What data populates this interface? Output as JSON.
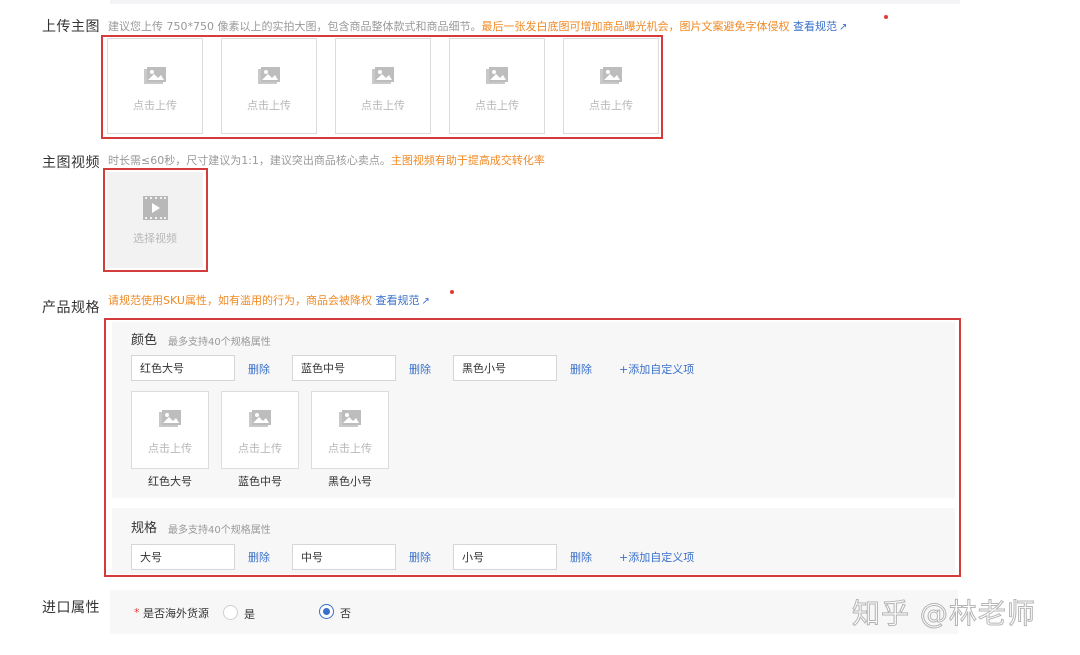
{
  "main_image": {
    "label": "上传主图",
    "hint_gray": "建议您上传 750*750 像素以上的实拍大图，包含商品整体款式和商品细节。",
    "hint_orange": "最后一张发白底图可增加商品曝光机会，图片文案避免字体侵权",
    "guide_link": "查看规范",
    "tiles": [
      "点击上传",
      "点击上传",
      "点击上传",
      "点击上传",
      "点击上传"
    ]
  },
  "main_video": {
    "label": "主图视频",
    "hint_gray": "时长需≤60秒，尺寸建议为1:1，建议突出商品核心卖点。",
    "hint_orange": "主图视频有助于提高成交转化率",
    "tile": "选择视频"
  },
  "product_spec": {
    "label": "产品规格",
    "hint_orange": "请规范使用SKU属性，如有滥用的行为，商品会被降权",
    "guide_link": "查看规范",
    "color": {
      "title": "颜色",
      "subtitle": "最多支持40个规格属性",
      "values": [
        "红色大号",
        "蓝色中号",
        "黑色小号"
      ],
      "delete_label": "删除",
      "add_label": "+添加自定义项",
      "tile_text": "点击上传",
      "captions": [
        "红色大号",
        "蓝色中号",
        "黑色小号"
      ]
    },
    "size": {
      "title": "规格",
      "subtitle": "最多支持40个规格属性",
      "values": [
        "大号",
        "中号",
        "小号"
      ],
      "delete_label": "删除",
      "add_label": "+添加自定义项"
    }
  },
  "import_attr": {
    "label": "进口属性",
    "required_mark": "*",
    "question": "是否海外货源",
    "option_yes": "是",
    "option_no": "否",
    "selected": "否"
  },
  "watermark": "知乎 @林老师",
  "icons": {
    "image": "image-placeholder-icon",
    "video": "video-play-icon",
    "external": "external-link-icon"
  },
  "colors": {
    "accent": "#3a70c9",
    "warning": "#f08a24",
    "highlight": "#d43c3c"
  }
}
